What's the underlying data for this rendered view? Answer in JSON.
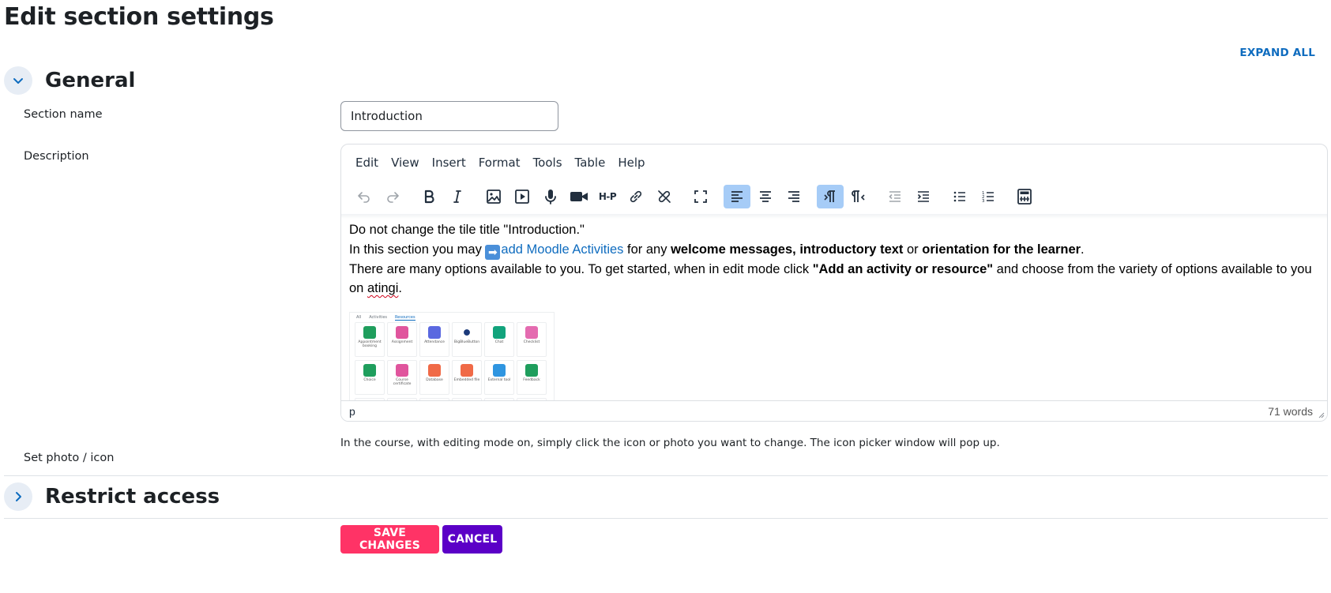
{
  "page": {
    "title": "Edit section settings",
    "expand_all": "EXPAND ALL"
  },
  "general": {
    "title": "General",
    "section_name_label": "Section name",
    "section_name_value": "Introduction",
    "description_label": "Description"
  },
  "editor": {
    "menu": [
      "Edit",
      "View",
      "Insert",
      "Format",
      "Tools",
      "Table",
      "Help"
    ],
    "toolbar_icons": [
      "undo-icon",
      "redo-icon",
      "bold-icon",
      "italic-icon",
      "image-icon",
      "media-icon",
      "microphone-icon",
      "video-camera-icon",
      "h5p-icon",
      "link-icon",
      "unlink-icon",
      "fullscreen-icon",
      "align-left-icon",
      "align-center-icon",
      "align-right-icon",
      "ltr-icon",
      "rtl-icon",
      "outdent-icon",
      "indent-icon",
      "bullet-list-icon",
      "numbered-list-icon",
      "calculator-icon"
    ],
    "h5p_label": "H-P",
    "content": {
      "line1": "Do not change the tile title \"Introduction.\"",
      "line2_pre": "In this section you may ",
      "line2_emoji": "➡",
      "line2_link": "add Moodle Activities",
      "line2_mid1": " for any ",
      "line2_bold1": "welcome messages, introductory text",
      "line2_mid2": " or ",
      "line2_bold2": "orientation for the learner",
      "line2_end": ".",
      "line3_pre": "There are many options available to you. To get started, when in edit mode click ",
      "line3_bold": "\"Add an activity or resource\"",
      "line3_post": " and choose from the variety of options available to you on ",
      "line3_misspelled": "atingi",
      "line3_end": "."
    },
    "thumbnail": {
      "tabs": [
        "All",
        "Activities",
        "Resources"
      ],
      "tiles": [
        {
          "name": "Appointment booking",
          "color": "#1f9e5d"
        },
        {
          "name": "Assignment",
          "color": "#e0559d"
        },
        {
          "name": "Attendance",
          "color": "#5a68e0"
        },
        {
          "name": "BigBlueButton",
          "color": "#ffffff"
        },
        {
          "name": "Chat",
          "color": "#12a37c"
        },
        {
          "name": "Checklist",
          "color": "#e46bb0"
        },
        {
          "name": "Choice",
          "color": "#1f9e5d"
        },
        {
          "name": "Course certificate",
          "color": "#e0559d"
        },
        {
          "name": "Database",
          "color": "#f06a47"
        },
        {
          "name": "Embedded file",
          "color": "#f06a47"
        },
        {
          "name": "External tool",
          "color": "#2f95e0"
        },
        {
          "name": "Feedback",
          "color": "#1f9e5d"
        }
      ]
    },
    "status_path": "p",
    "word_count": "71 words"
  },
  "photo": {
    "label": "Set photo / icon",
    "help": "In the course, with editing mode on, simply click the icon or photo you want to change. The icon picker window will pop up."
  },
  "restrict": {
    "title": "Restrict access"
  },
  "buttons": {
    "save": "SAVE CHANGES",
    "cancel": "CANCEL"
  },
  "colors": {
    "accent": "#0f6cbf",
    "save": "#ff3366",
    "cancel": "#5b00c7",
    "active_tool": "#a6ccf7"
  }
}
